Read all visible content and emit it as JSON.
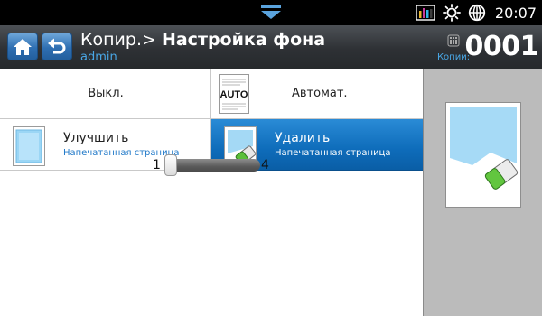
{
  "status": {
    "time": "20:07",
    "icons": [
      "bar-graph-icon",
      "brightness-icon",
      "globe-icon"
    ]
  },
  "header": {
    "title_prefix": "Копир.>",
    "title_main": "Настройка фона",
    "user": "admin",
    "copies_label": "Копии:",
    "copies_count": "0001"
  },
  "options": {
    "off": "Выкл.",
    "auto": "Автомат.",
    "auto_badge": "AUTO",
    "enhance_title": "Улучшить",
    "enhance_sub": "Напечатанная страница",
    "erase_title": "Удалить",
    "erase_sub": "Напечатанная страница",
    "selected": "erase"
  },
  "slider": {
    "min": "1",
    "max": "4",
    "value": 1
  },
  "colors": {
    "accent": "#1f78c8",
    "selected_bg": "#0e6cba",
    "header_bg": "#2e3135"
  }
}
